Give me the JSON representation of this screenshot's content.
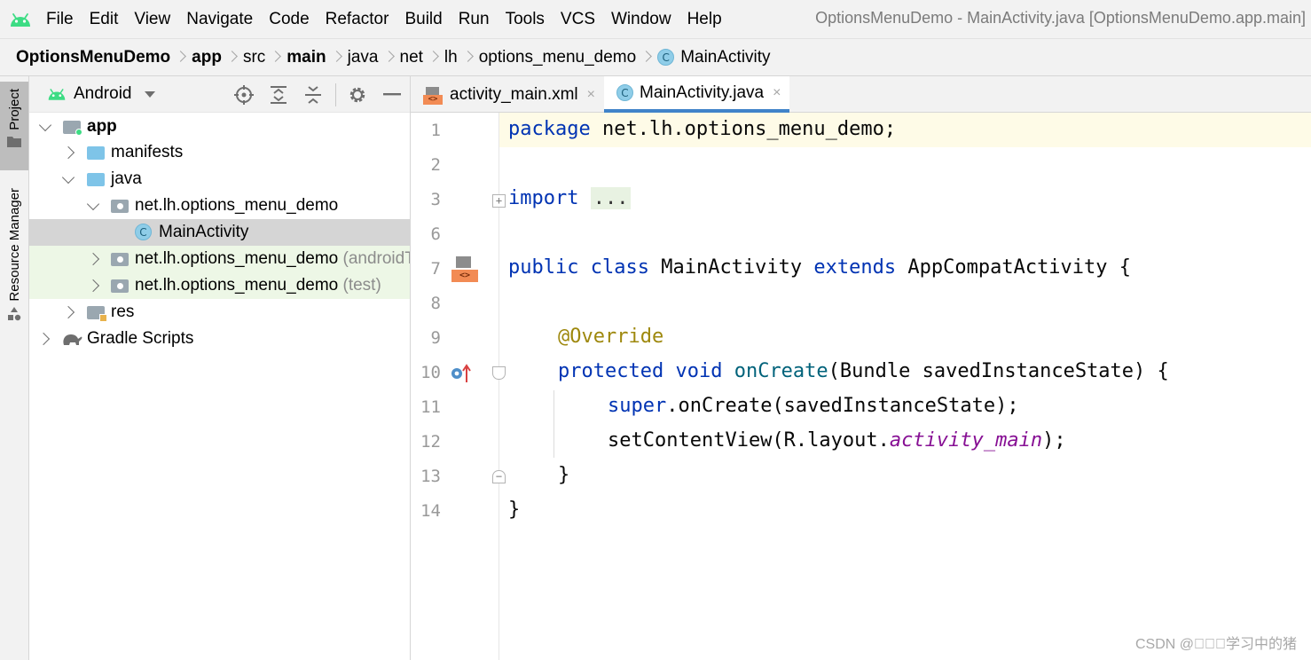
{
  "menubar": {
    "items": [
      "File",
      "Edit",
      "View",
      "Navigate",
      "Code",
      "Refactor",
      "Build",
      "Run",
      "Tools",
      "VCS",
      "Window",
      "Help"
    ],
    "window_title": "OptionsMenuDemo - MainActivity.java [OptionsMenuDemo.app.main]"
  },
  "breadcrumb": {
    "items": [
      "OptionsMenuDemo",
      "app",
      "src",
      "main",
      "java",
      "net",
      "lh",
      "options_menu_demo",
      "MainActivity"
    ],
    "class_badge": "C"
  },
  "sidebar": {
    "project_tab": "Project",
    "resource_tab": "Resource Manager"
  },
  "project_panel": {
    "view_label": "Android",
    "tree": [
      {
        "label": "app"
      },
      {
        "label": "manifests"
      },
      {
        "label": "java"
      },
      {
        "label": "net.lh.options_menu_demo"
      },
      {
        "label": "MainActivity",
        "badge": "C"
      },
      {
        "label": "net.lh.options_menu_demo",
        "suffix": "(androidTest)"
      },
      {
        "label": "net.lh.options_menu_demo",
        "suffix": "(test)"
      },
      {
        "label": "res"
      },
      {
        "label": "Gradle Scripts"
      }
    ]
  },
  "editor": {
    "tabs": [
      {
        "label": "activity_main.xml",
        "close": "×",
        "icon_text": "<>"
      },
      {
        "label": "MainActivity.java",
        "close": "×",
        "icon_text": "C"
      }
    ],
    "line_numbers": [
      "1",
      "2",
      "3",
      "6",
      "7",
      "8",
      "9",
      "10",
      "11",
      "12",
      "13",
      "14"
    ],
    "code": {
      "l1_kw": "package",
      "l1_rest": " net.lh.options_menu_demo;",
      "l3_kw": "import",
      "l3_fold": "...",
      "l7_kw1": "public",
      "l7_kw2": "class",
      "l7_name": " MainActivity ",
      "l7_kw3": "extends",
      "l7_rest": " AppCompatActivity {",
      "l9_ann": "@Override",
      "l10_kw1": "protected",
      "l10_kw2": "void",
      "l10_fn": "onCreate",
      "l10_rest": "(Bundle savedInstanceState) {",
      "l11_kw": "super",
      "l11_rest": ".onCreate(savedInstanceState);",
      "l12_pre": "setContentView(R.layout.",
      "l12_field": "activity_main",
      "l12_post": ");",
      "l13": "}",
      "l14": "}"
    },
    "gutter_icon_text": "<>"
  },
  "watermark": "CSDN @\u0000\u0000\u0000学习中的猪"
}
